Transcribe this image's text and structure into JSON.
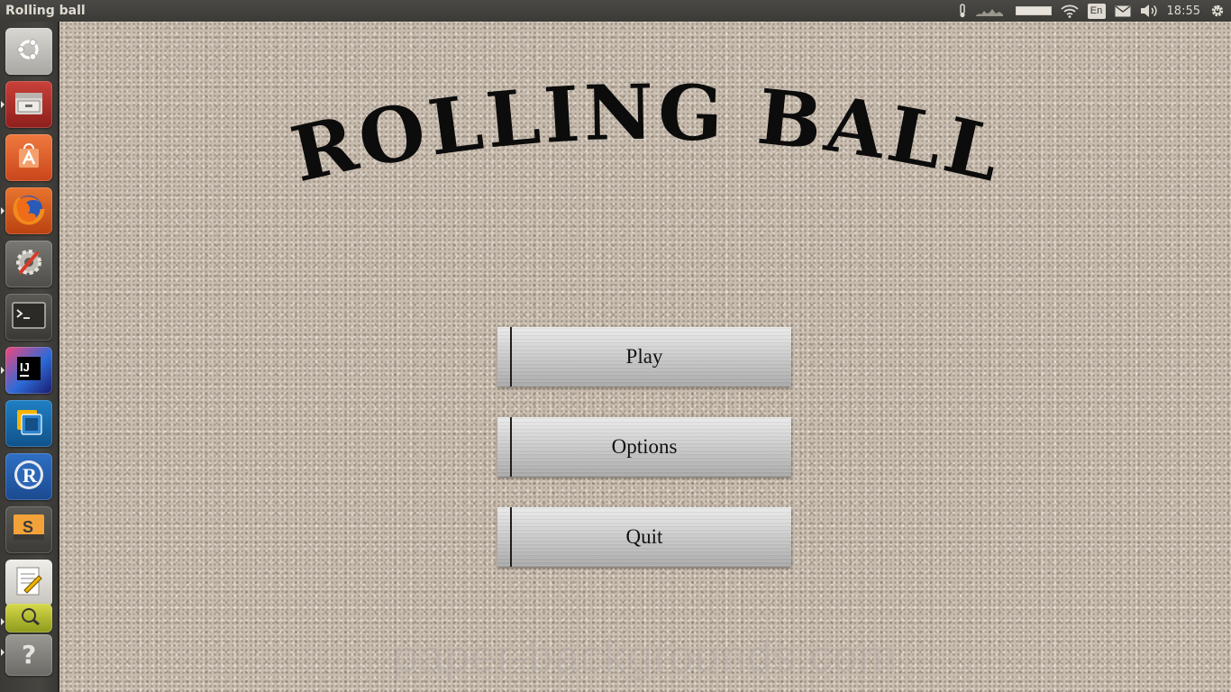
{
  "top_panel": {
    "window_title": "Rolling ball",
    "indicators": {
      "keyboard_layout": "En",
      "clock": "18:55"
    }
  },
  "launcher": {
    "items": [
      {
        "name": "dash-home",
        "icon": "ubuntu-logo-icon"
      },
      {
        "name": "files",
        "icon": "file-cabinet-icon"
      },
      {
        "name": "software-center",
        "icon": "shopping-bag-icon"
      },
      {
        "name": "firefox",
        "icon": "firefox-icon"
      },
      {
        "name": "system-settings",
        "icon": "settings-wrench-icon"
      },
      {
        "name": "terminal",
        "icon": "terminal-icon"
      },
      {
        "name": "intellij-idea",
        "icon": "intellij-icon"
      },
      {
        "name": "virtualbox",
        "icon": "virtualbox-icon"
      },
      {
        "name": "r-language",
        "icon": "r-logo-icon"
      },
      {
        "name": "sublime-text",
        "icon": "sublime-icon"
      },
      {
        "name": "text-editor",
        "icon": "text-editor-icon"
      },
      {
        "name": "image-viewer",
        "icon": "image-viewer-icon"
      },
      {
        "name": "unknown-app",
        "icon": "question-mark-icon"
      }
    ]
  },
  "game": {
    "title": "Rolling ball",
    "title_display": "ROLLING BALL",
    "buttons": {
      "play": "Play",
      "options": "Options",
      "quit": "Quit"
    },
    "watermark": "paper-backgrounds.com"
  }
}
